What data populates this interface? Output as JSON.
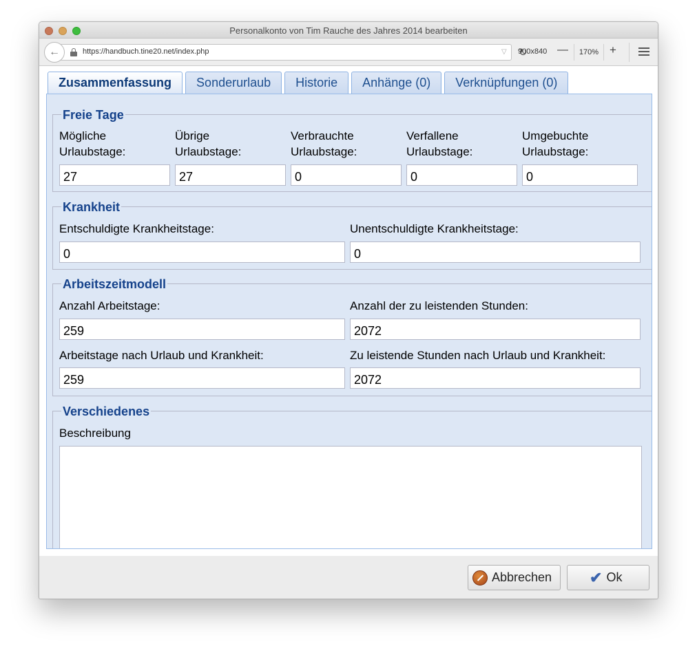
{
  "window": {
    "title": "Personalkonto von Tim Rauche des Jahres 2014 bearbeiten"
  },
  "browser": {
    "url": "https://handbuch.tine20.net/index.php",
    "viewport_size": "900x840",
    "zoom_out": "—",
    "zoom_level": "170%",
    "zoom_in": "+"
  },
  "tabs": [
    {
      "label": "Zusammenfassung",
      "active": true
    },
    {
      "label": "Sonderurlaub",
      "active": false
    },
    {
      "label": "Historie",
      "active": false
    },
    {
      "label": "Anhänge (0)",
      "active": false
    },
    {
      "label": "Verknüpfungen (0)",
      "active": false
    }
  ],
  "freie_tage": {
    "legend": "Freie Tage",
    "fields": [
      {
        "label1": "Mögliche",
        "label2": "Urlaubstage:",
        "value": "27"
      },
      {
        "label1": "Übrige",
        "label2": "Urlaubstage:",
        "value": "27"
      },
      {
        "label1": "Verbrauchte",
        "label2": "Urlaubstage:",
        "value": "0"
      },
      {
        "label1": "Verfallene",
        "label2": "Urlaubstage:",
        "value": "0"
      },
      {
        "label1": "Umgebuchte",
        "label2": "Urlaubstage:",
        "value": "0"
      }
    ]
  },
  "krankheit": {
    "legend": "Krankheit",
    "fields": [
      {
        "label": "Entschuldigte Krankheitstage:",
        "value": "0"
      },
      {
        "label": "Unentschuldigte Krankheitstage:",
        "value": "0"
      }
    ]
  },
  "arbeitszeitmodell": {
    "legend": "Arbeitszeitmodell",
    "fields": [
      {
        "label": "Anzahl Arbeitstage:",
        "value": "259"
      },
      {
        "label": "Anzahl der zu leistenden Stunden:",
        "value": "2072"
      },
      {
        "label": "Arbeitstage nach Urlaub und Krankheit:",
        "value": "259"
      },
      {
        "label": "Zu leistende Stunden nach Urlaub und Krankheit:",
        "value": "2072"
      }
    ]
  },
  "verschiedenes": {
    "legend": "Verschiedenes",
    "description_label": "Beschreibung",
    "description_value": ""
  },
  "buttons": {
    "cancel": "Abbrechen",
    "ok": "Ok"
  },
  "colors": {
    "panel_bg": "#dde7f5",
    "legend": "#15428b",
    "tab_border": "#8db2e3"
  }
}
